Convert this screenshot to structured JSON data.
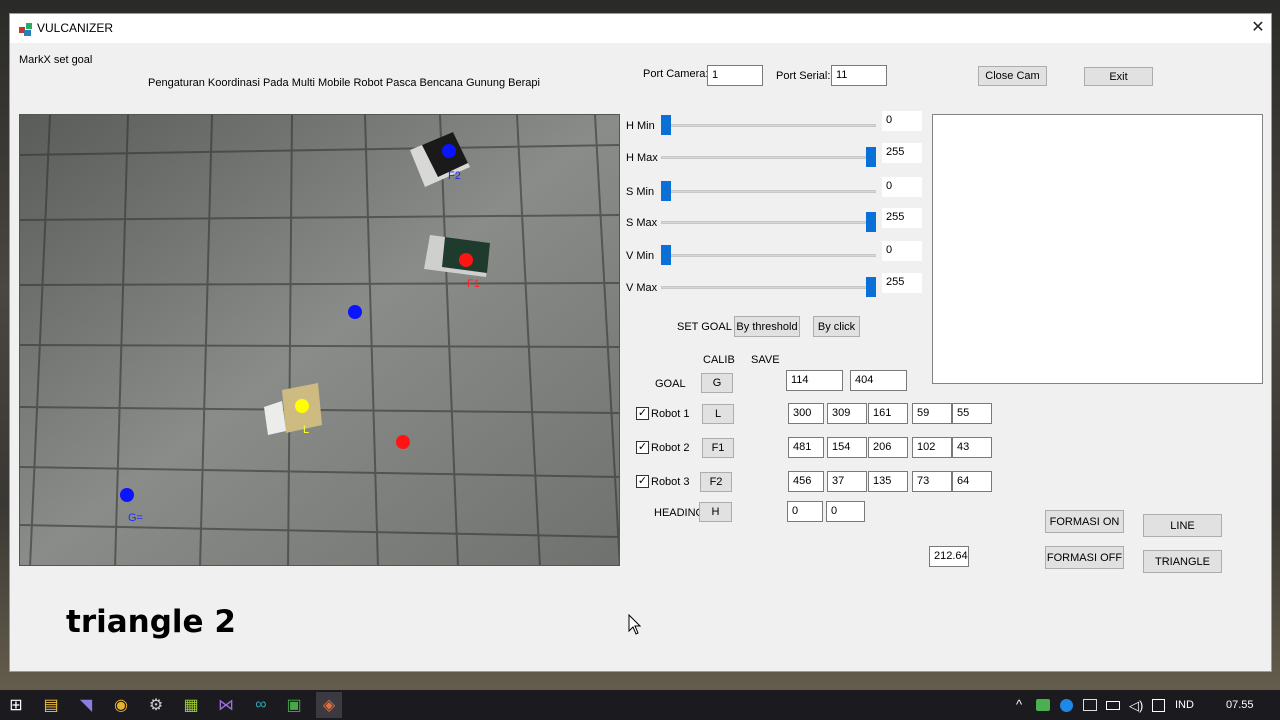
{
  "window": {
    "title": "VULCANIZER",
    "close_glyph": "✕"
  },
  "status_label": "MarkX set goal",
  "subtitle": "Pengaturan Koordinasi Pada Multi Mobile Robot Pasca Bencana Gunung Berapi",
  "ports": {
    "camera_label": "Port Camera:",
    "camera_value": "1",
    "serial_label": "Port Serial:",
    "serial_value": "11"
  },
  "buttons": {
    "close_cam": "Close Cam",
    "exit": "Exit"
  },
  "sliders": [
    {
      "label": "H Min",
      "value": "0",
      "fraction": 0.0
    },
    {
      "label": "H Max",
      "value": "255",
      "fraction": 1.0
    },
    {
      "label": "S Min",
      "value": "0",
      "fraction": 0.0
    },
    {
      "label": "S Max",
      "value": "255",
      "fraction": 1.0
    },
    {
      "label": "V Min",
      "value": "0",
      "fraction": 0.0
    },
    {
      "label": "V Max",
      "value": "255",
      "fraction": 1.0
    }
  ],
  "set_goal": {
    "label": "SET GOAL",
    "by_threshold": "By threshold",
    "by_click": "By click"
  },
  "grid_headers": {
    "calib": "CALIB",
    "save": "SAVE"
  },
  "goal": {
    "label": "GOAL",
    "button": "G",
    "values": [
      "114",
      "404"
    ]
  },
  "robots": [
    {
      "label": "Robot 1",
      "checked": true,
      "button": "L",
      "values": [
        "300",
        "309",
        "161",
        "59",
        "55"
      ]
    },
    {
      "label": "Robot 2",
      "checked": true,
      "button": "F1",
      "values": [
        "481",
        "154",
        "206",
        "102",
        "43"
      ]
    },
    {
      "label": "Robot 3",
      "checked": true,
      "button": "F2",
      "values": [
        "456",
        "37",
        "135",
        "73",
        "64"
      ]
    }
  ],
  "heading": {
    "label": "HEADING",
    "button": "H",
    "values": [
      "0",
      "0"
    ]
  },
  "formation": {
    "on": "FORMASI ON",
    "off": "FORMASI OFF",
    "line": "LINE",
    "triangle": "TRIANGLE"
  },
  "angle_value": "212.64",
  "mode_text": "triangle 2",
  "camera_labels": {
    "f2": "F2",
    "f1": "F1",
    "l": "L",
    "goal": "G="
  },
  "marker_colors": {
    "blue": "#0a14ff",
    "red": "#ff1414",
    "yellow": "#ffff00"
  },
  "taskbar": {
    "language": "IND",
    "time": "07.55",
    "icons": [
      "start-icon",
      "file-explorer-icon",
      "visual-studio-code-icon",
      "chrome-icon",
      "settings-icon",
      "notepad-icon",
      "visual-studio-icon",
      "arduino-icon",
      "excel-icon",
      "vulcanizer-app-icon"
    ]
  }
}
